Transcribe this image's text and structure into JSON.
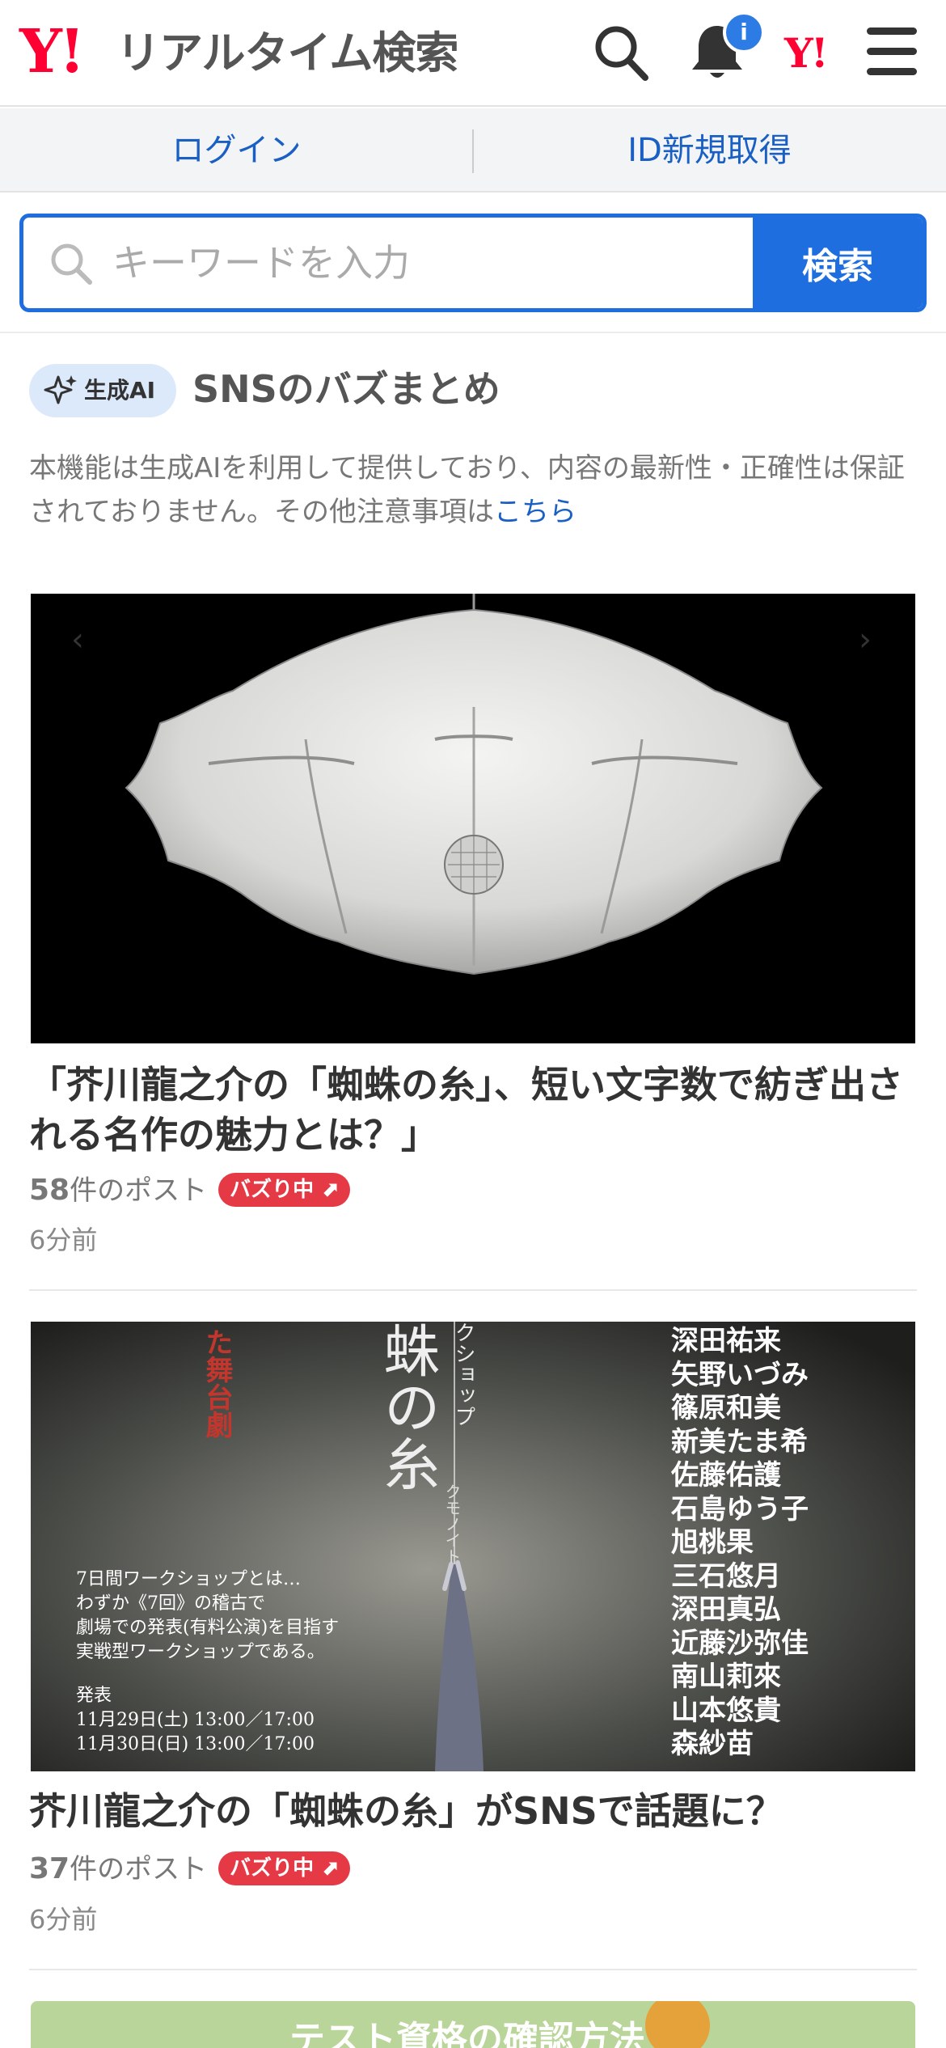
{
  "header": {
    "logo_mark": "Y!",
    "logo_text": "リアルタイム検索",
    "notification_count": "i",
    "yahoo_mark": "Y!"
  },
  "auth": {
    "login": "ログイン",
    "signup": "ID新規取得"
  },
  "search": {
    "placeholder": "キーワードを入力",
    "button": "検索"
  },
  "sns_section": {
    "ai_badge": "生成AI",
    "title": "SNSのバズまとめ",
    "disclaimer": "本機能は生成AIを利用して提供しており、内容の最新性・正確性は保証されておりません。その他注意事項は",
    "disclaimer_link": "こちら"
  },
  "cards": [
    {
      "title": "「芥川龍之介の「蜘蛛の糸」、短い文字数で紡ぎ出される名作の魅力とは？」",
      "count": "58",
      "count_suffix": "件のポスト",
      "buzz": "バズり中",
      "time": "6分前"
    },
    {
      "title": "芥川龍之介の「蜘蛛の糸」がSNSで話題に？",
      "count": "37",
      "count_suffix": "件のポスト",
      "buzz": "バズり中",
      "time": "6分前",
      "poster": {
        "top_left": "た舞台劇",
        "center_title": "蛛の糸",
        "center_sub": "クショップ",
        "center_ruby": "クモノイト",
        "description_lines": [
          "7日間ワークショップとは…",
          "わずか《7回》の稽古で",
          "劇場での発表(有料公演)を目指す",
          "実戦型ワークショップである。"
        ],
        "event_label": "発表",
        "dates": [
          "11月29日(土) 13:00／17:00",
          "11月30日(日) 13:00／17:00"
        ],
        "cast": [
          "深田祐来",
          "矢野いづみ",
          "篠原和美",
          "新美たま希",
          "佐藤佑護",
          "石島ゆう子",
          "旭桃果",
          "三石悠月",
          "深田真弘",
          "近藤沙弥佳",
          "南山莉來",
          "山本悠貴",
          "森紗苗"
        ]
      }
    }
  ],
  "third_card": {
    "partial_text": "テスト資格の確認方法"
  }
}
